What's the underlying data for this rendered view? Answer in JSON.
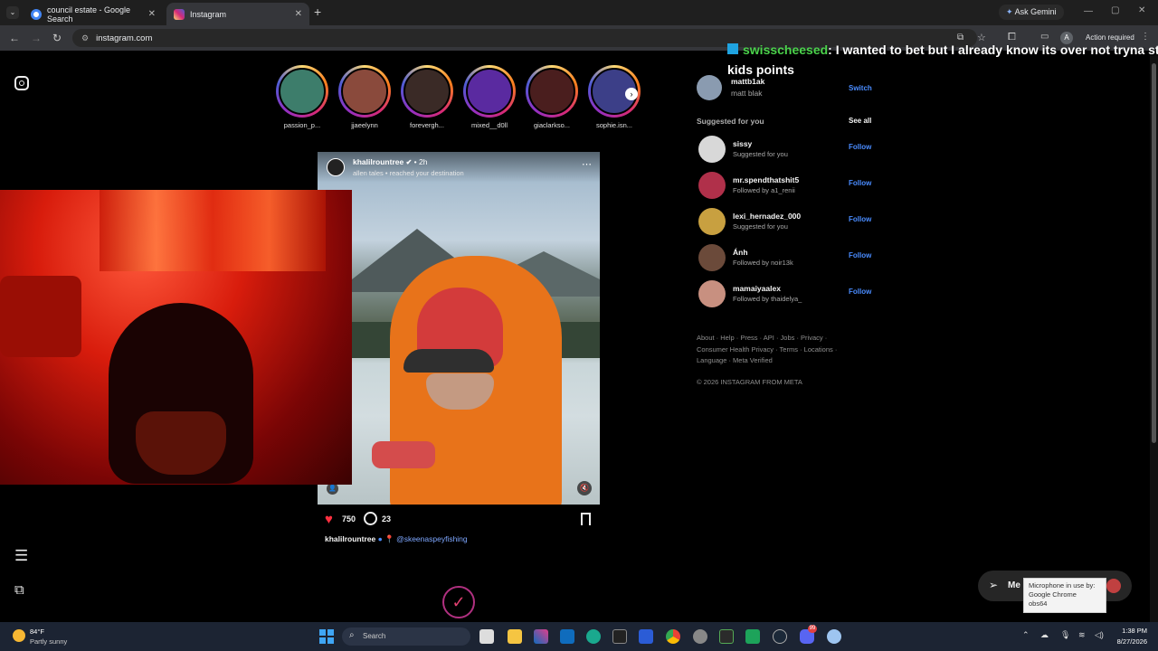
{
  "browser": {
    "tabs": [
      {
        "title": "council estate - Google Search",
        "favicon_color": "#4285f4"
      },
      {
        "title": "Instagram",
        "favicon_color": "#d62976"
      }
    ],
    "new_tab": "+",
    "ask_gemini": "Ask Gemini",
    "url": "instagram.com",
    "action_required": "Action required",
    "profile_initial": "A"
  },
  "overlay_chat": {
    "username": "swisscheesed",
    "message": ": I wanted to bet but I already know its over not tryna st",
    "message_line2": "kids points"
  },
  "stories": [
    {
      "name": "passion_p...",
      "color": "#3d7d6b"
    },
    {
      "name": "jjaeelynn",
      "color": "#8a4a3c"
    },
    {
      "name": "forevergh...",
      "color": "#3a2a26"
    },
    {
      "name": "mixed__d0ll",
      "color": "#5a2aa0"
    },
    {
      "name": "giaclarkso...",
      "color": "#4a1e1e"
    },
    {
      "name": "sophie.isn...",
      "color": "#3c3f88"
    }
  ],
  "post": {
    "author": "khalilrountree",
    "time": "• 2h",
    "audio": "allen tales • reached your destination",
    "likes": "750",
    "comments": "23",
    "caption_author": "khalilrountree",
    "caption_location_tag": "@skeenaspeyfishing"
  },
  "profile": {
    "username": "mattb1ak",
    "display_name": "matt blak",
    "switch_label": "Switch"
  },
  "suggested": {
    "header": "Suggested for you",
    "see_all": "See all",
    "follow_label": "Follow",
    "items": [
      {
        "name": "sissy",
        "sub": "Suggested for you",
        "color": "#d8d8d8"
      },
      {
        "name": "mr.spendthatshit5",
        "sub": "Followed by a1_renii",
        "color": "#b0304a"
      },
      {
        "name": "lexi_hernadez_000",
        "sub": "Suggested for you",
        "color": "#c8a040"
      },
      {
        "name": "Ánh",
        "sub": "Followed by noir13k",
        "color": "#6b4a3a"
      },
      {
        "name": "mamaiyaalex",
        "sub": "Followed by thaidelya_",
        "color": "#c89080"
      }
    ]
  },
  "footer": {
    "links_line1": "About · Help · Press · API · Jobs · Privacy ·",
    "links_line2": "Consumer Health Privacy · Terms · Locations ·",
    "links_line3": "Language · Meta Verified",
    "copyright": "© 2026 INSTAGRAM FROM META"
  },
  "messages_button": "Me",
  "mic_tooltip": {
    "line1": "Microphone in use by:",
    "line2": "Google Chrome",
    "line3": "obs64"
  },
  "taskbar": {
    "temp": "84°F",
    "weather": "Partly sunny",
    "search_placeholder": "Search",
    "time": "1:38 PM",
    "date": "8/27/2026",
    "discord_badge": "99"
  }
}
